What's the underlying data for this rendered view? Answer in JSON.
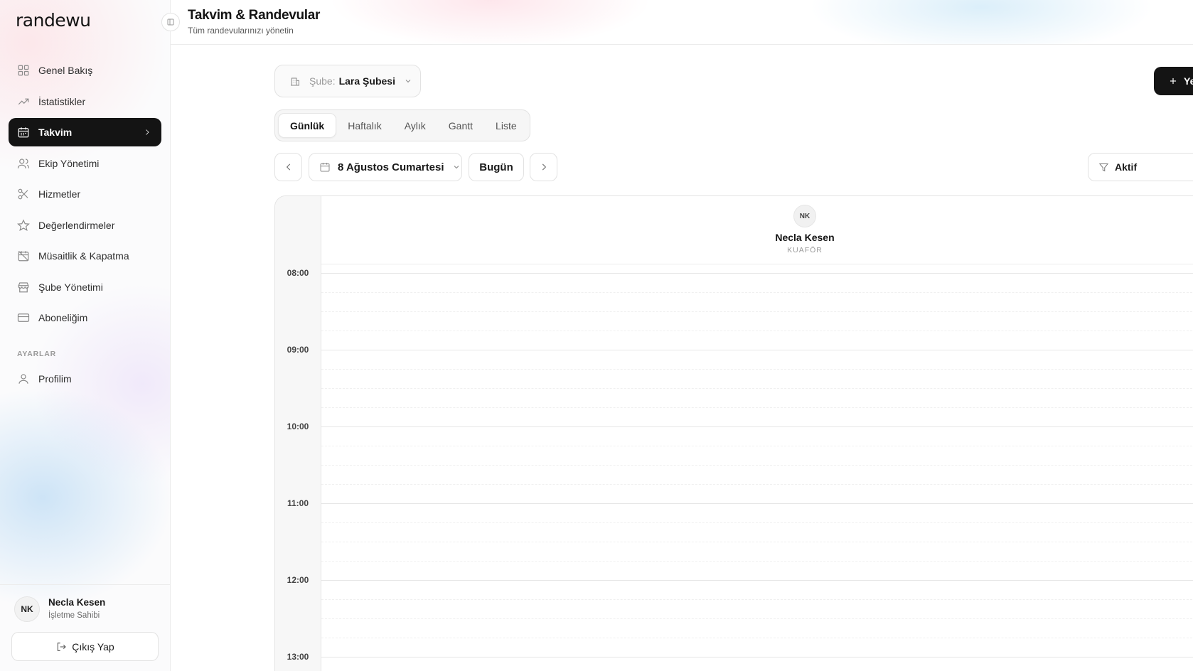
{
  "app": {
    "logo": "randewu"
  },
  "sidebar": {
    "items": [
      {
        "label": "Genel Bakış",
        "icon": "grid-icon"
      },
      {
        "label": "İstatistikler",
        "icon": "trend-icon"
      },
      {
        "label": "Takvim",
        "icon": "calendar-icon",
        "active": true
      },
      {
        "label": "Ekip Yönetimi",
        "icon": "users-icon"
      },
      {
        "label": "Hizmetler",
        "icon": "scissors-icon"
      },
      {
        "label": "Değerlendirmeler",
        "icon": "star-icon"
      },
      {
        "label": "Müsaitlik & Kapatma",
        "icon": "calendar-off-icon"
      },
      {
        "label": "Şube Yönetimi",
        "icon": "store-icon"
      },
      {
        "label": "Aboneliğim",
        "icon": "card-icon"
      }
    ],
    "settings_section": "AYARLAR",
    "settings_items": [
      {
        "label": "Profilim",
        "icon": "user-icon"
      }
    ],
    "user": {
      "initials": "NK",
      "name": "Necla Kesen",
      "role": "İşletme Sahibi"
    },
    "logout_label": "Çıkış Yap"
  },
  "header": {
    "title": "Takvim & Randevular",
    "subtitle": "Tüm randevularınızı yönetin"
  },
  "toolbar": {
    "branch_label": "Şube:",
    "branch_value": "Lara Şubesi",
    "new_button": "Ye",
    "tabs": [
      "Günlük",
      "Haftalık",
      "Aylık",
      "Gantt",
      "Liste"
    ],
    "active_tab": "Günlük",
    "date": "8 Ağustos Cumartesi",
    "today": "Bugün",
    "filter": "Aktif"
  },
  "calendar": {
    "staff": {
      "initials": "NK",
      "name": "Necla Kesen",
      "role": "KUAFÖR"
    },
    "hours": [
      "08:00",
      "09:00",
      "10:00",
      "11:00",
      "12:00",
      "13:00"
    ]
  }
}
